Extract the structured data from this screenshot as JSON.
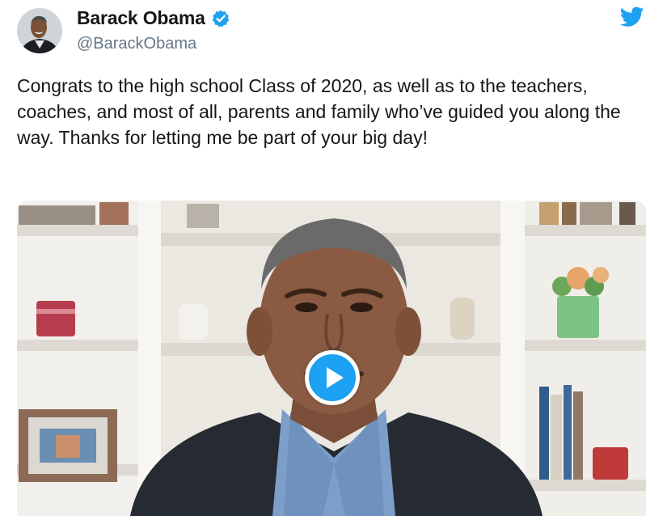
{
  "author": {
    "display_name": "Barack Obama",
    "handle": "@BarackObama",
    "verified": true,
    "avatar_icon": "avatar-photo",
    "verified_icon": "verified-badge-icon"
  },
  "tweet": {
    "text": "Congrats to the high school Class of 2020, as well as to the teachers, coaches, and most of all, parents and family who’ve guided you along the way. Thanks for letting me be part of your big day!"
  },
  "media": {
    "type": "video",
    "play_icon": "play-icon"
  },
  "brand": {
    "icon": "twitter-bird-icon",
    "accent": "#1da1f2"
  }
}
